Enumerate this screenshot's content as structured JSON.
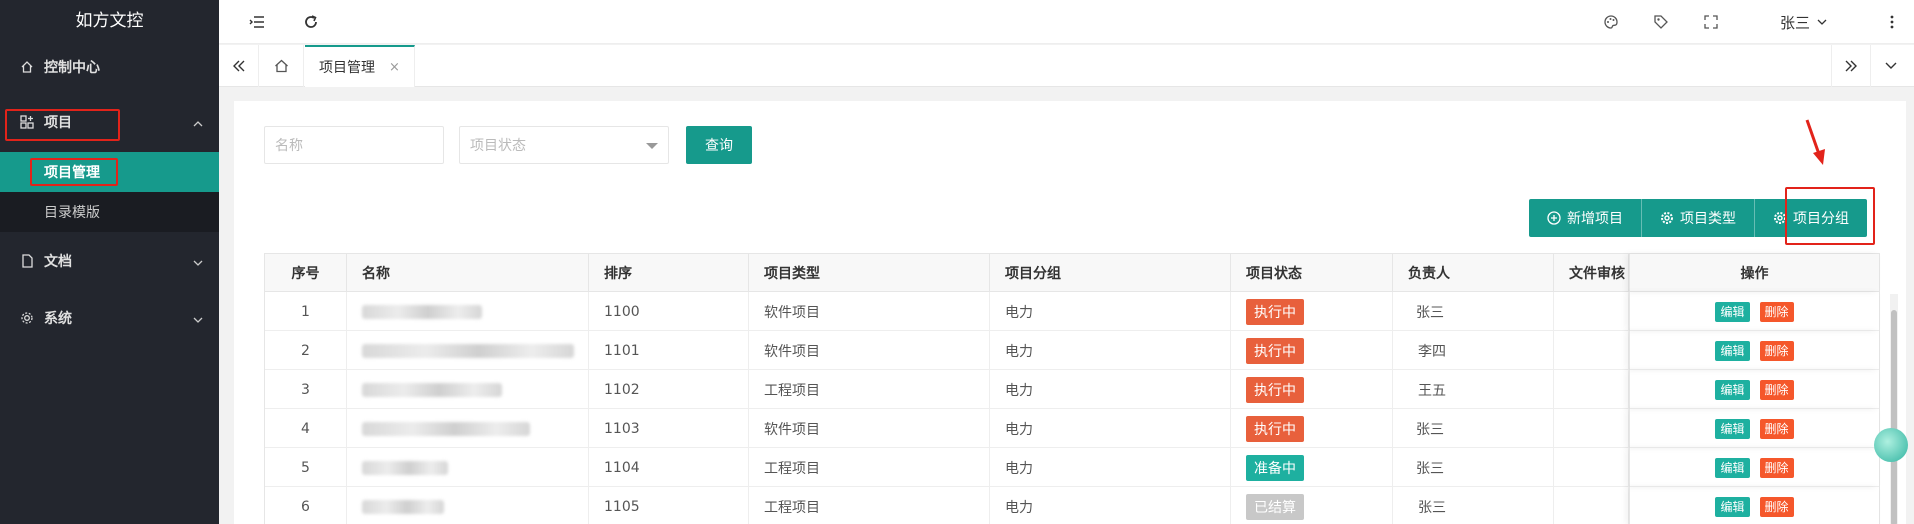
{
  "app": {
    "title": "如方文控"
  },
  "sidebar": {
    "items": [
      {
        "label": "控制中心",
        "icon": "home-icon"
      },
      {
        "label": "项目",
        "icon": "apps-icon"
      },
      {
        "label": "文档",
        "icon": "document-icon"
      },
      {
        "label": "系统",
        "icon": "gear-icon"
      }
    ],
    "project_sub": [
      {
        "label": "项目管理"
      },
      {
        "label": "目录模版"
      }
    ]
  },
  "topbar": {
    "user": "张三"
  },
  "tabs": {
    "active_label": "项目管理",
    "close_glyph": "×"
  },
  "search": {
    "name_placeholder": "名称",
    "status_placeholder": "项目状态",
    "query_label": "查询"
  },
  "actions": {
    "add_label": "新增项目",
    "type_label": "项目类型",
    "group_label": "项目分组"
  },
  "table": {
    "headers": {
      "index": "序号",
      "name": "名称",
      "order": "排序",
      "type": "项目类型",
      "group": "项目分组",
      "status": "项目状态",
      "owner": "负责人",
      "review": "文件审核",
      "ops": "操作"
    },
    "rows": [
      {
        "index": "1",
        "order": "1100",
        "type": "软件项目",
        "group": "电力",
        "status": "执行中",
        "owner": "张三"
      },
      {
        "index": "2",
        "order": "1101",
        "type": "软件项目",
        "group": "电力",
        "status": "执行中",
        "owner": "李四"
      },
      {
        "index": "3",
        "order": "1102",
        "type": "工程项目",
        "group": "电力",
        "status": "执行中",
        "owner": "王五"
      },
      {
        "index": "4",
        "order": "1103",
        "type": "软件项目",
        "group": "电力",
        "status": "执行中",
        "owner": "张三"
      },
      {
        "index": "5",
        "order": "1104",
        "type": "工程项目",
        "group": "电力",
        "status": "准备中",
        "owner": "张三"
      },
      {
        "index": "6",
        "order": "1105",
        "type": "工程项目",
        "group": "电力",
        "status": "已结算",
        "owner": "张三"
      }
    ],
    "edit_label": "编辑",
    "delete_label": "删除"
  },
  "colors": {
    "accent": "#169a8c",
    "sidebar_bg": "#23262e",
    "status_running": "#e8603c",
    "status_prepare": "#1eb0a0",
    "status_settled": "#c8c8c8",
    "edit_btn": "#1eb0a0",
    "delete_btn": "#f5572b",
    "highlight": "#e2231a"
  }
}
